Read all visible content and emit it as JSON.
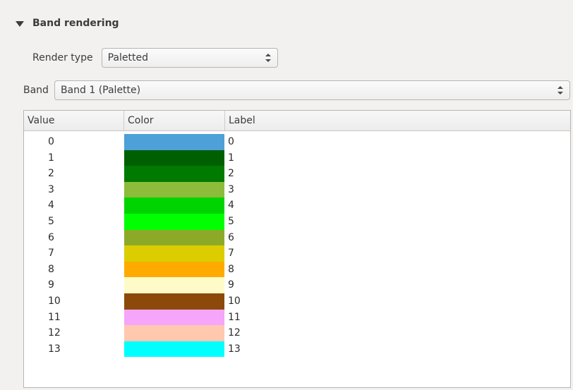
{
  "section": {
    "title": "Band rendering"
  },
  "render_type": {
    "label": "Render type",
    "value": "Paletted"
  },
  "band": {
    "label": "Band",
    "value": "Band 1 (Palette)"
  },
  "table": {
    "headers": [
      "Value",
      "Color",
      "Label"
    ],
    "rows": [
      {
        "value": "0",
        "color": "#4da0d8",
        "label": "0"
      },
      {
        "value": "1",
        "color": "#005f00",
        "label": "1"
      },
      {
        "value": "2",
        "color": "#007a00",
        "label": "2"
      },
      {
        "value": "3",
        "color": "#8cbc3a",
        "label": "3"
      },
      {
        "value": "4",
        "color": "#00d400",
        "label": "4"
      },
      {
        "value": "5",
        "color": "#00ff00",
        "label": "5"
      },
      {
        "value": "6",
        "color": "#8caa28",
        "label": "6"
      },
      {
        "value": "7",
        "color": "#dccd00",
        "label": "7"
      },
      {
        "value": "8",
        "color": "#ffaa00",
        "label": "8"
      },
      {
        "value": "9",
        "color": "#fffbc8",
        "label": "9"
      },
      {
        "value": "10",
        "color": "#8c4a0a",
        "label": "10"
      },
      {
        "value": "11",
        "color": "#f5a5fa",
        "label": "11"
      },
      {
        "value": "12",
        "color": "#ffc8af",
        "label": "12"
      },
      {
        "value": "13",
        "color": "#00ffff",
        "label": "13"
      }
    ]
  }
}
